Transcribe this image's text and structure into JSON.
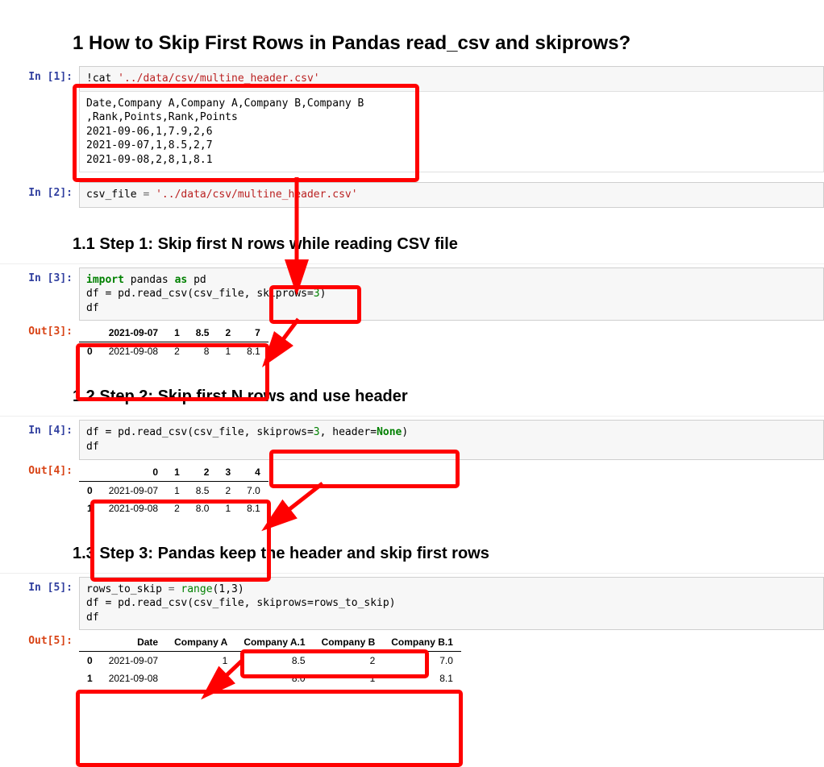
{
  "headings": {
    "h1": "1  How to Skip First Rows in Pandas read_csv and skiprows?",
    "h2a": "1.1  Step 1: Skip first N rows while reading CSV file",
    "h2b": "1.2  Step 2: Skip first N rows and use header",
    "h2c": "1.3  Step 3: Pandas keep the header and skip first rows"
  },
  "prompts": {
    "in1": "In [1]:",
    "in2": "In [2]:",
    "in3": "In [3]:",
    "in4": "In [4]:",
    "in5": "In [5]:",
    "out3": "Out[3]:",
    "out4": "Out[4]:",
    "out5": "Out[5]:"
  },
  "cells": {
    "c1": {
      "prefix": "!cat ",
      "path": "'../data/csv/multine_header.csv'",
      "output": "Date,Company A,Company A,Company B,Company B\n,Rank,Points,Rank,Points\n2021-09-06,1,7.9,2,6\n2021-09-07,1,8.5,2,7\n2021-09-08,2,8,1,8.1"
    },
    "c2": {
      "lhs": "csv_file ",
      "eq": "= ",
      "path": "'../data/csv/multine_header.csv'"
    },
    "c3": {
      "l1_import": "import",
      "l1_mid": " pandas ",
      "l1_as": "as",
      "l1_pd": " pd",
      "l2_pre": "df = pd.read_csv(csv_file, ",
      "l2_kw": "skiprows",
      "l2_eq": "=",
      "l2_val": "3",
      "l2_post": ")",
      "l3": "df"
    },
    "c4": {
      "l1_pre": "df = pd.read_csv(csv_file, ",
      "l1_kw1": "skiprows",
      "l1_eq1": "=",
      "l1_v1": "3",
      "l1_comma": ", ",
      "l1_kw2": "header",
      "l1_eq2": "=",
      "l1_none": "None",
      "l1_post": ")",
      "l2": "df"
    },
    "c5": {
      "l1_lhs": "rows_to_skip ",
      "l1_eq": "= ",
      "l1_fn": "range",
      "l1_args": "(1,3)",
      "l2_pre": "df = pd.read_csv(csv_file, ",
      "l2_kw": "skiprows",
      "l2_eq": "=",
      "l2_val": "rows_to_skip",
      "l2_post": ")",
      "l3": "df"
    }
  },
  "tables": {
    "t3": {
      "headers": [
        "",
        "2021-09-07",
        "1",
        "8.5",
        "2",
        "7"
      ],
      "rows": [
        [
          "0",
          "2021-09-08",
          "2",
          "8",
          "1",
          "8.1"
        ]
      ]
    },
    "t4": {
      "headers": [
        "",
        "0",
        "1",
        "2",
        "3",
        "4"
      ],
      "rows": [
        [
          "0",
          "2021-09-07",
          "1",
          "8.5",
          "2",
          "7.0"
        ],
        [
          "1",
          "2021-09-08",
          "2",
          "8.0",
          "1",
          "8.1"
        ]
      ]
    },
    "t5": {
      "headers": [
        "",
        "Date",
        "Company A",
        "Company A.1",
        "Company B",
        "Company B.1"
      ],
      "rows": [
        [
          "0",
          "2021-09-07",
          "1",
          "8.5",
          "2",
          "7.0"
        ],
        [
          "1",
          "2021-09-08",
          "2",
          "8.0",
          "1",
          "8.1"
        ]
      ]
    }
  }
}
